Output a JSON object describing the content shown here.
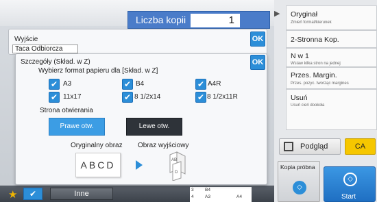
{
  "header": {
    "copies_label": "Liczba kopii",
    "copies_value": "1"
  },
  "right_menu": [
    {
      "title": "Oryginał",
      "subtitle": "Zmień format/kierunek"
    },
    {
      "title": "2-Stronna Kop.",
      "subtitle": ""
    },
    {
      "title": "N w 1",
      "subtitle": "Wstaw kilka stron na jednej"
    },
    {
      "title": "Przes. Margin.",
      "subtitle": "Przes. pozyc. tworząc margines"
    },
    {
      "title": "Usuń",
      "subtitle": "Usuń cień dookoła"
    }
  ],
  "actions": {
    "preview_label": "Podgląd",
    "ca_label": "CA",
    "proof_label": "Kopia próbna",
    "start_label": "Start"
  },
  "bottom_bar": {
    "other_label": "Inne",
    "trays": [
      "3",
      "B4",
      "4",
      "A3",
      "A4"
    ]
  },
  "output_panel": {
    "title": "Wyjście",
    "tray_value": "Taca Odbiorcza",
    "ok_label": "OK"
  },
  "details_dialog": {
    "title": "Szczegóły (Skład. w Z)",
    "ok_label": "OK",
    "paper_prompt": "Wybierz format papieru dla [Skład. w Z]",
    "paper_sizes": [
      {
        "label": "A3",
        "checked": true
      },
      {
        "label": "B4",
        "checked": true
      },
      {
        "label": "A4R",
        "checked": true
      },
      {
        "label": "11x17",
        "checked": true
      },
      {
        "label": "8 1/2x14",
        "checked": true
      },
      {
        "label": "8 1/2x11R",
        "checked": true
      }
    ],
    "opening_side_label": "Strona otwierania",
    "opening_right": "Prawe otw.",
    "opening_left": "Lewe otw.",
    "opening_selected": "Prawe otw.",
    "original_image_label": "Oryginalny obraz",
    "output_image_label": "Obraz wyjściowy",
    "original_sample_text": "ABCD"
  },
  "colors": {
    "accent": "#2c8ed8",
    "ca": "#f6c700",
    "dark_button": "#2e3339"
  }
}
